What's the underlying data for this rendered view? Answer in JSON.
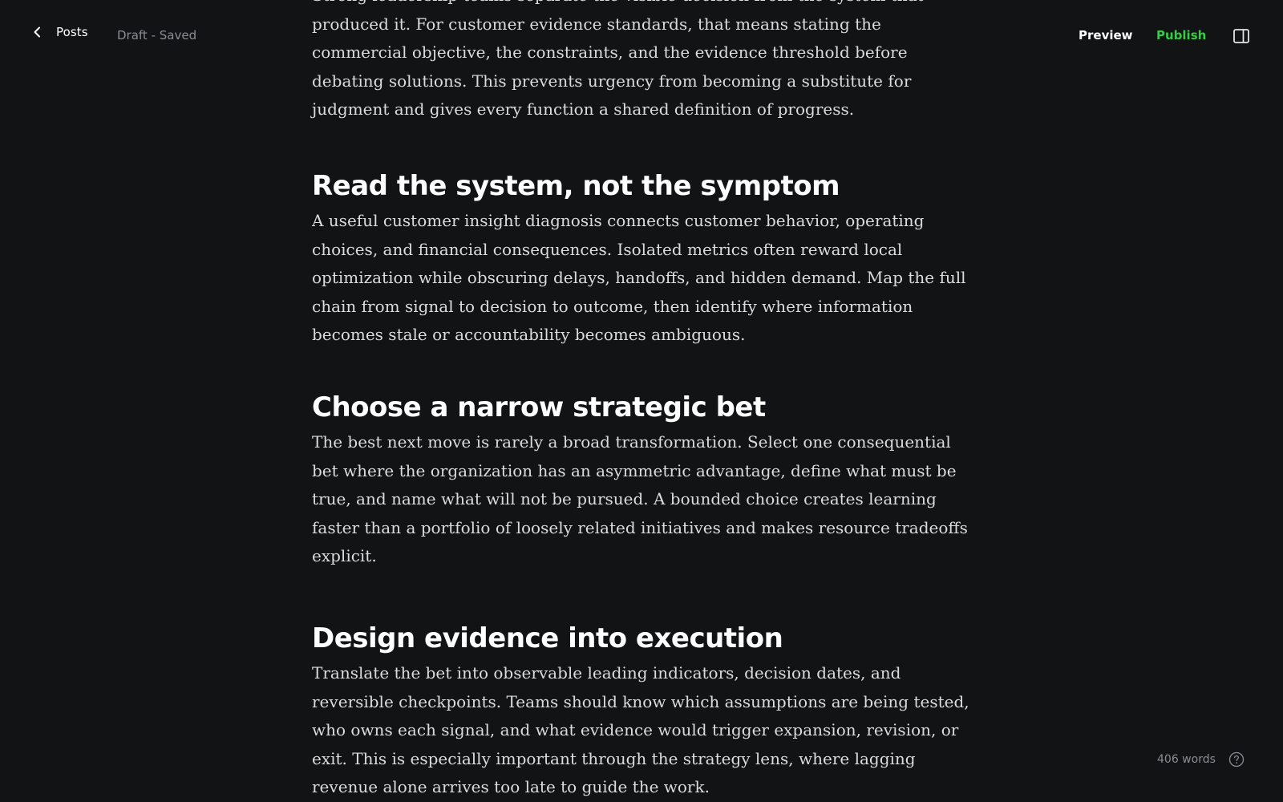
{
  "header": {
    "back_label": "Posts",
    "status": "Draft - Saved",
    "preview_label": "Preview",
    "publish_label": "Publish"
  },
  "colors": {
    "background": "#111315",
    "publish": "#30cf43",
    "muted": "#8a8e92"
  },
  "icons": {
    "back": "chevron-left-icon",
    "sidebar": "sidebar-toggle-icon",
    "help": "help-circle-icon"
  },
  "article": {
    "intro_paragraph": "Strong leadership teams separate the visible decision from the system that produced it. For customer evidence standards, that means stating the commercial objective, the constraints, and the evidence threshold before debating solutions. This prevents urgency from becoming a substitute for judgment and gives every function a shared definition of progress.",
    "sections": [
      {
        "heading": "Read the system, not the symptom",
        "body": "A useful customer insight diagnosis connects customer behavior, operating choices, and financial consequences. Isolated metrics often reward local optimization while obscuring delays, handoffs, and hidden demand. Map the full chain from signal to decision to outcome, then identify where information becomes stale or accountability becomes ambiguous."
      },
      {
        "heading": "Choose a narrow strategic bet",
        "body": "The best next move is rarely a broad transformation. Select one consequential bet where the organization has an asymmetric advantage, define what must be true, and name what will not be pursued. A bounded choice creates learning faster than a portfolio of loosely related initiatives and makes resource tradeoffs explicit."
      },
      {
        "heading": "Design evidence into execution",
        "body": "Translate the bet into observable leading indicators, decision dates, and reversible checkpoints. Teams should know which assumptions are being tested, who owns each signal, and what evidence would trigger expansion, revision, or exit. This is especially important through the strategy lens, where lagging revenue alone arrives too late to guide the work."
      }
    ]
  },
  "footer": {
    "word_count": "406 words"
  }
}
